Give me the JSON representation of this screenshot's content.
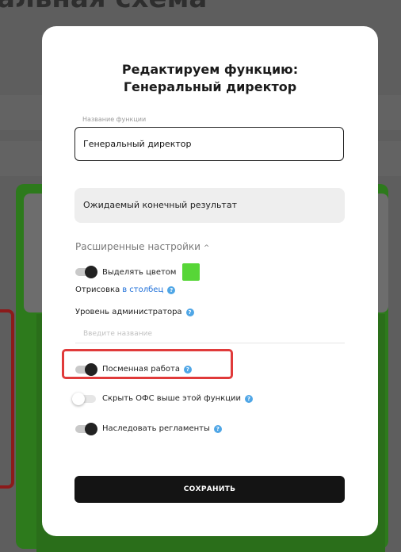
{
  "background": {
    "title_fragment": "альная схема"
  },
  "modal": {
    "title_line1": "Редактируем функцию:",
    "title_line2": "Генеральный директор",
    "function_name": {
      "label": "Название функции",
      "value": "Генеральный директор"
    },
    "expected_result": {
      "placeholder": "Ожидаемый конечный результат"
    },
    "advanced": {
      "label": "Расширенные настройки",
      "chevron": "chevron-up-icon"
    },
    "highlight_color": {
      "label": "Выделять цветом",
      "enabled": true,
      "color": "#57d637"
    },
    "rendering": {
      "label": "Отрисовка",
      "value": "в столбец"
    },
    "admin_level": {
      "label": "Уровень администратора",
      "placeholder": "Введите название"
    },
    "shift_work": {
      "label": "Посменная работа",
      "enabled": true
    },
    "hide_ofs": {
      "label": "Скрыть ОФС выше этой функции",
      "enabled": false
    },
    "inherit_regulations": {
      "label": "Наследовать регламенты",
      "enabled": true
    },
    "save_label": "СОХРАНИТЬ",
    "help_icon": "help-icon",
    "colors": {
      "accent_link": "#1e6fd9",
      "help": "#4fa6e6",
      "highlight_frame": "#e03a3a",
      "button": "#141414"
    }
  }
}
